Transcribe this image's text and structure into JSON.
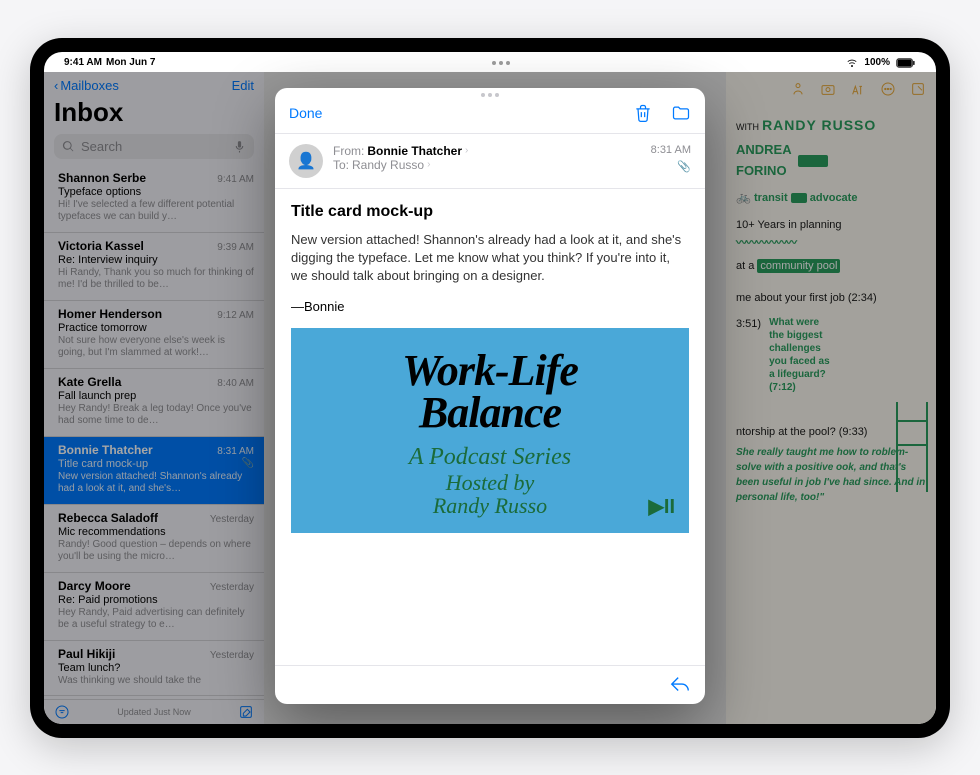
{
  "status": {
    "time": "9:41 AM",
    "date": "Mon Jun 7",
    "battery": "100%",
    "wifi": "wifi"
  },
  "mail": {
    "back": "Mailboxes",
    "edit": "Edit",
    "title": "Inbox",
    "search_placeholder": "Search",
    "footer_status": "Updated Just Now",
    "items": [
      {
        "sender": "Shannon Serbe",
        "time": "9:41 AM",
        "subject": "Typeface options",
        "preview": "Hi! I've selected a few different potential typefaces we can build y…"
      },
      {
        "sender": "Victoria Kassel",
        "time": "9:39 AM",
        "subject": "Re: Interview inquiry",
        "preview": "Hi Randy, Thank you so much for thinking of me! I'd be thrilled to be…"
      },
      {
        "sender": "Homer Henderson",
        "time": "9:12 AM",
        "subject": "Practice tomorrow",
        "preview": "Not sure how everyone else's week is going, but I'm slammed at work!…"
      },
      {
        "sender": "Kate Grella",
        "time": "8:40 AM",
        "subject": "Fall launch prep",
        "preview": "Hey Randy! Break a leg today! Once you've had some time to de…"
      },
      {
        "sender": "Bonnie Thatcher",
        "time": "8:31 AM",
        "subject": "Title card mock-up",
        "preview": "New version attached! Shannon's already had a look at it, and she's…",
        "selected": true,
        "attachment": true
      },
      {
        "sender": "Rebecca Saladoff",
        "time": "Yesterday",
        "subject": "Mic recommendations",
        "preview": "Randy! Good question – depends on where you'll be using the micro…"
      },
      {
        "sender": "Darcy Moore",
        "time": "Yesterday",
        "subject": "Re: Paid promotions",
        "preview": "Hey Randy, Paid advertising can definitely be a useful strategy to e…"
      },
      {
        "sender": "Paul Hikiji",
        "time": "Yesterday",
        "subject": "Team lunch?",
        "preview": "Was thinking we should take the"
      }
    ]
  },
  "modal": {
    "done": "Done",
    "from_label": "From:",
    "from_name": "Bonnie Thatcher",
    "to_label": "To:",
    "to_name": "Randy Russo",
    "time": "8:31 AM",
    "subject": "Title card mock-up",
    "body": "New version attached! Shannon's already had a look at it, and she's digging the typeface. Let me know what you think? If you're into it, we should talk about bringing on a designer.",
    "signature": "—Bonnie",
    "card": {
      "title1": "Work-Life",
      "title2": "Balance",
      "sub1": "A Podcast Series",
      "sub2a": "Hosted by",
      "sub2b": "Randy Russo",
      "play": "▶II"
    }
  },
  "notes": {
    "line_with": "WITH",
    "randy": "RANDY RUSSO",
    "andrea": "ANDREA",
    "forino": "FORINO",
    "transit": "transit",
    "advocate": "advocate",
    "years": "10+ Years in planning",
    "at_a": "at a",
    "pool": "community pool",
    "q1": "me about your first job (2:34)",
    "time1": "3:51)",
    "q2a": "What were",
    "q2b": "the biggest",
    "q2c": "challenges",
    "q2d": "you faced as",
    "q2e": "a lifeguard?",
    "q2f": "(7:12)",
    "q3": "ntorship at the pool? (9:33)",
    "quote": "She really taught me how to roblem-solve with a positive ook, and that's been useful in job I've had since. And in personal life, too!\""
  }
}
